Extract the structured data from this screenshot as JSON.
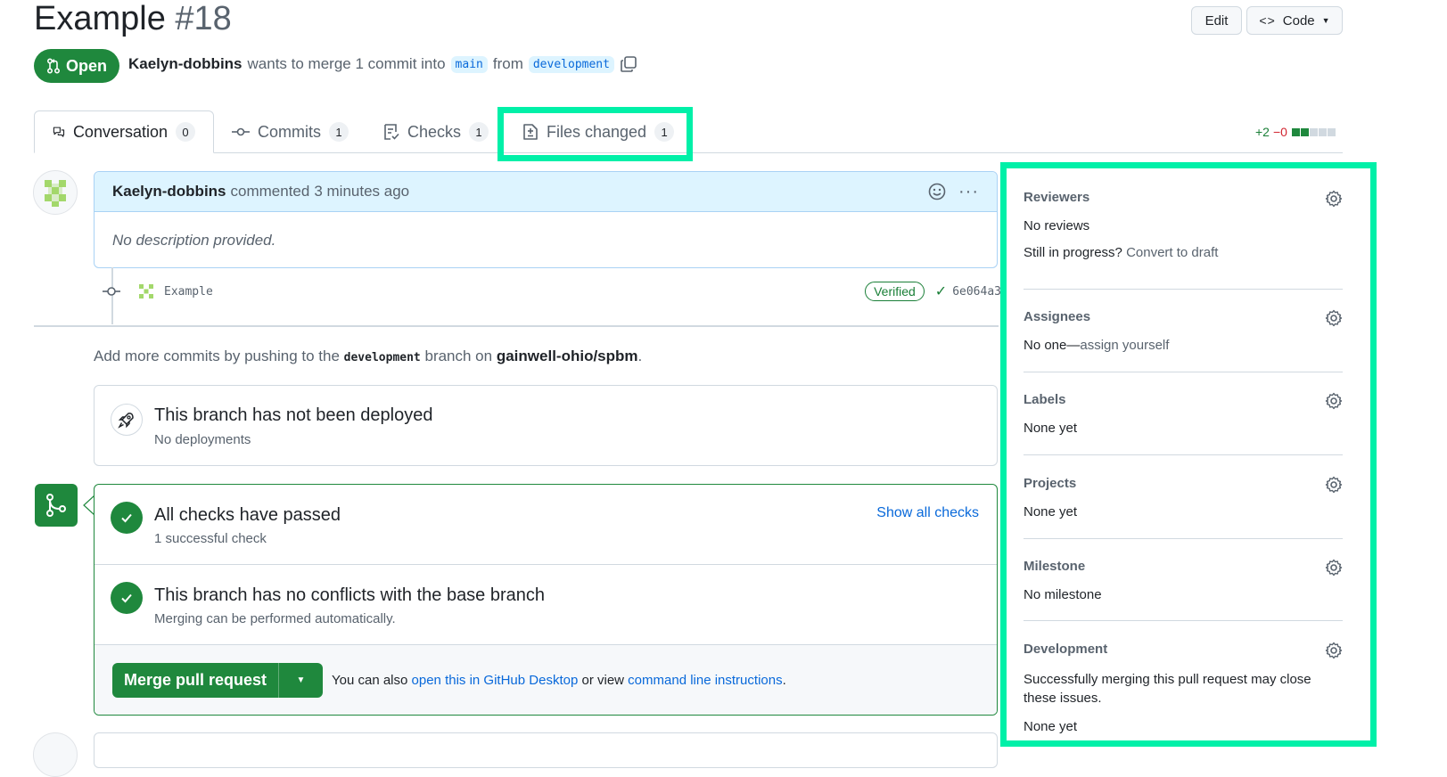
{
  "header": {
    "title": "Example",
    "number": "#18",
    "edit_label": "Edit",
    "code_label": "Code",
    "state": "Open",
    "author": "Kaelyn-dobbins",
    "merge_text": "wants to merge 1 commit into",
    "base_branch": "main",
    "from_text": "from",
    "head_branch": "development"
  },
  "tabs": [
    {
      "label": "Conversation",
      "count": "0"
    },
    {
      "label": "Commits",
      "count": "1"
    },
    {
      "label": "Checks",
      "count": "1"
    },
    {
      "label": "Files changed",
      "count": "1"
    }
  ],
  "diffstat": {
    "additions": "+2",
    "deletions": "−0",
    "boxes": [
      "green",
      "green",
      "gray",
      "gray",
      "gray"
    ]
  },
  "comment": {
    "author": "Kaelyn-dobbins",
    "action": "commented",
    "time": "3 minutes ago",
    "body": "No description provided."
  },
  "commit": {
    "message": "Example",
    "verified": "Verified",
    "sha": "6e064a3"
  },
  "push_hint": {
    "prefix": "Add more commits by pushing to the",
    "branch": "development",
    "middle": "branch on",
    "repo": "gainwell-ohio/spbm",
    "suffix": "."
  },
  "deploy": {
    "title": "This branch has not been deployed",
    "subtitle": "No deployments"
  },
  "checks": {
    "title": "All checks have passed",
    "subtitle": "1 successful check",
    "show_all": "Show all checks",
    "conflict_title": "This branch has no conflicts with the base branch",
    "conflict_subtitle": "Merging can be performed automatically."
  },
  "merge": {
    "button_label": "Merge pull request",
    "also_text": "You can also",
    "desktop_link": "open this in GitHub Desktop",
    "or_text": "or view",
    "cli_link": "command line instructions",
    "period": "."
  },
  "sidebar": {
    "reviewers": {
      "title": "Reviewers",
      "value": "No reviews",
      "draft_prefix": "Still in progress?",
      "draft_link": "Convert to draft"
    },
    "assignees": {
      "title": "Assignees",
      "value": "No one—",
      "assign_link": "assign yourself"
    },
    "labels": {
      "title": "Labels",
      "value": "None yet"
    },
    "projects": {
      "title": "Projects",
      "value": "None yet"
    },
    "milestone": {
      "title": "Milestone",
      "value": "No milestone"
    },
    "development": {
      "title": "Development",
      "value": "Successfully merging this pull request may close these issues.",
      "none": "None yet"
    }
  },
  "colors": {
    "highlight": "#00f0a8",
    "success": "#1f883d",
    "accent": "#0969da"
  }
}
